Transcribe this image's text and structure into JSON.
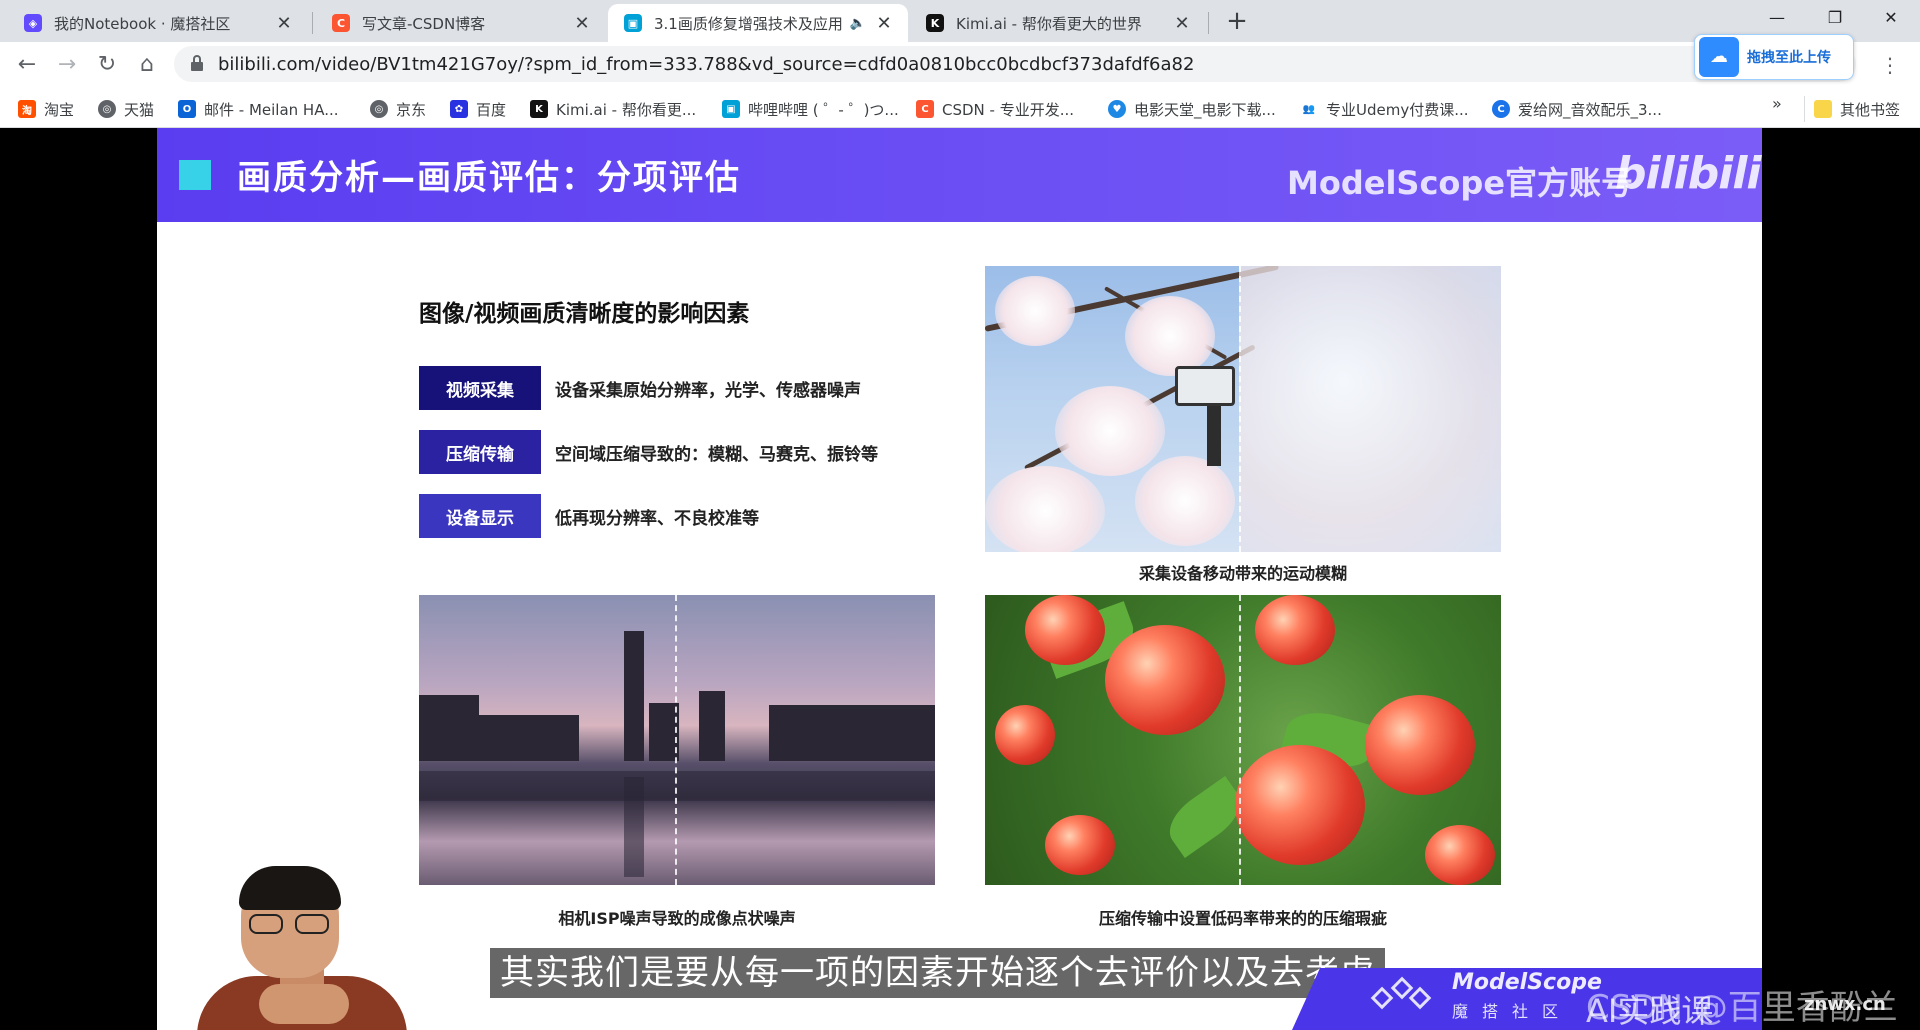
{
  "tabs": [
    {
      "title": "我的Notebook · 魔搭社区",
      "favicon_color": "#624aff",
      "favicon_glyph": "◈"
    },
    {
      "title": "写文章-CSDN博客",
      "favicon_color": "#fc5531",
      "favicon_glyph": "C"
    },
    {
      "title": "3.1画质修复增强技术及应用",
      "favicon_color": "#00a1d6",
      "favicon_glyph": "▣",
      "active": true,
      "playing_audio": true
    },
    {
      "title": "Kimi.ai - 帮你看更大的世界",
      "favicon_color": "#111111",
      "favicon_glyph": "K"
    }
  ],
  "new_tab_label": "+",
  "window_controls": {
    "minimize": "—",
    "restore": "❐",
    "close": "✕"
  },
  "toolbar": {
    "back": "←",
    "forward": "→",
    "reload": "↻",
    "home": "⌂",
    "url": "bilibili.com/video/BV1tm421G7oy/?spm_id_from=333.788&vd_source=cdfd0a0810bcc0bcdbcf373dafdf6a82",
    "upload_label": "拖拽至此上传",
    "menu": "⋮"
  },
  "bookmarks": [
    {
      "label": "淘宝",
      "color": "#ff5000",
      "glyph": "淘"
    },
    {
      "label": "天猫",
      "color": "#5f6368",
      "glyph": "◎"
    },
    {
      "label": "邮件 - Meilan HA...",
      "color": "#0a64d6",
      "glyph": "O"
    },
    {
      "label": "京东",
      "color": "#5f6368",
      "glyph": "◎"
    },
    {
      "label": "百度",
      "color": "#2932e1",
      "glyph": "✿"
    },
    {
      "label": "Kimi.ai - 帮你看更...",
      "color": "#111111",
      "glyph": "K"
    },
    {
      "label": "哔哩哔哩 ( ゜- ゜)つ...",
      "color": "#00a1d6",
      "glyph": "▣"
    },
    {
      "label": "CSDN - 专业开发...",
      "color": "#fc5531",
      "glyph": "C"
    },
    {
      "label": "电影天堂_电影下载...",
      "color": "#1e88e5",
      "glyph": "♥"
    },
    {
      "label": "专业Udemy付费课...",
      "color": "#6d6d6d",
      "glyph": "👥"
    },
    {
      "label": "爱给网_音效配乐_3...",
      "color": "#1a73e8",
      "glyph": "C"
    }
  ],
  "bookmarks_more": "»",
  "other_bookmarks": "其他书签",
  "slide": {
    "header_title": "画质分析—画质评估：分项评估",
    "header_brand": "ModelScope官方账号",
    "header_logo": "bilibili",
    "section_title": "图像/视频画质清晰度的影响因素",
    "factors": [
      {
        "tag": "视频采集",
        "desc": "设备采集原始分辨率，光学、传感器噪声",
        "color": "#16127a"
      },
      {
        "tag": "压缩传输",
        "desc": "空间域压缩导致的：模糊、马赛克、振铃等",
        "color": "#2a22a0"
      },
      {
        "tag": "设备显示",
        "desc": "低再现分辨率、不良校准等",
        "color": "#3a36c0"
      }
    ],
    "captions": {
      "blossom": "采集设备移动带来的运动模糊",
      "city": "相机ISP噪声导致的成像点状噪声",
      "apples": "压缩传输中设置低码率带来的的压缩瑕疵"
    }
  },
  "subtitle": "其实我们是要从每一项的因素开始逐个去评价以及去考虑",
  "badge": {
    "name": "ModelScope",
    "sub": "魔搭社区",
    "course": "AI实践课",
    "watermark": "CSDN @百里香酚兰",
    "watermark_small": "znwx.cn"
  }
}
